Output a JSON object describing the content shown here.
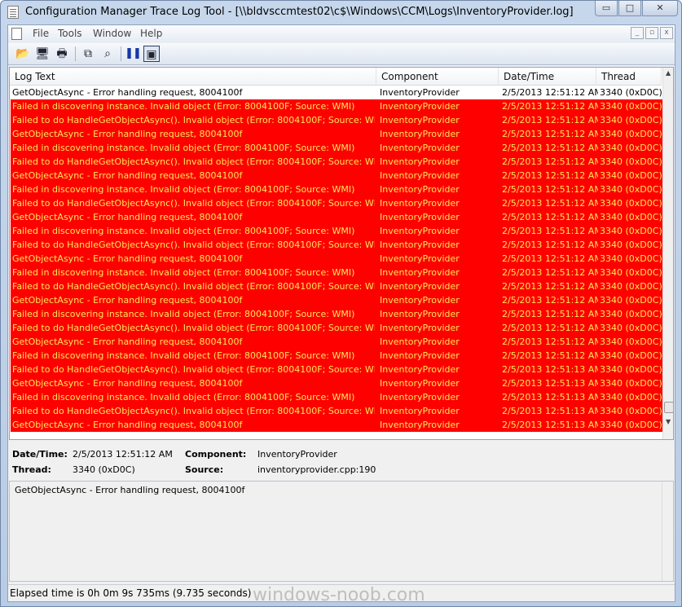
{
  "window": {
    "title": "Configuration Manager Trace Log Tool - [\\\\bldvsccmtest02\\c$\\Windows\\CCM\\Logs\\InventoryProvider.log]",
    "minimize_glyph": "▭",
    "maximize_glyph": "□",
    "close_glyph": "✕"
  },
  "menu": {
    "items": [
      "File",
      "Tools",
      "Window",
      "Help"
    ],
    "mdi_minimize": "_",
    "mdi_restore": "▫",
    "mdi_close": "x"
  },
  "toolbar": {
    "icons": [
      "open-folder-icon",
      "computer-icon",
      "print-icon",
      "copy-icon",
      "find-icon",
      "pause-icon",
      "highlight-icon"
    ],
    "open_glyph": "📂",
    "computer_glyph": "🖥",
    "print_glyph": "🖶",
    "copy_glyph": "⧉",
    "find_glyph": "⌕",
    "pause_glyph": "❚❚",
    "view_glyph": "▣"
  },
  "log": {
    "columns": [
      "Log Text",
      "Component",
      "Date/Time",
      "Thread"
    ],
    "rows": [
      {
        "text": "GetObjectAsync - Error handling request, 8004100f",
        "component": "InventoryProvider",
        "datetime": "2/5/2013 12:51:12 AM",
        "thread": "3340 (0xD0C)"
      },
      {
        "text": "Failed in discovering instance. Invalid object (Error: 8004100F; Source: WMI)",
        "component": "InventoryProvider",
        "datetime": "2/5/2013 12:51:12 AM",
        "thread": "3340 (0xD0C)"
      },
      {
        "text": "Failed to do HandleGetObjectAsync(). Invalid object (Error: 8004100F; Source: WMI)",
        "component": "InventoryProvider",
        "datetime": "2/5/2013 12:51:12 AM",
        "thread": "3340 (0xD0C)"
      },
      {
        "text": "GetObjectAsync - Error handling request, 8004100f",
        "component": "InventoryProvider",
        "datetime": "2/5/2013 12:51:12 AM",
        "thread": "3340 (0xD0C)"
      },
      {
        "text": "Failed in discovering instance. Invalid object (Error: 8004100F; Source: WMI)",
        "component": "InventoryProvider",
        "datetime": "2/5/2013 12:51:12 AM",
        "thread": "3340 (0xD0C)"
      },
      {
        "text": "Failed to do HandleGetObjectAsync(). Invalid object (Error: 8004100F; Source: WMI)",
        "component": "InventoryProvider",
        "datetime": "2/5/2013 12:51:12 AM",
        "thread": "3340 (0xD0C)"
      },
      {
        "text": "GetObjectAsync - Error handling request, 8004100f",
        "component": "InventoryProvider",
        "datetime": "2/5/2013 12:51:12 AM",
        "thread": "3340 (0xD0C)"
      },
      {
        "text": "Failed in discovering instance. Invalid object (Error: 8004100F; Source: WMI)",
        "component": "InventoryProvider",
        "datetime": "2/5/2013 12:51:12 AM",
        "thread": "3340 (0xD0C)"
      },
      {
        "text": "Failed to do HandleGetObjectAsync(). Invalid object (Error: 8004100F; Source: WMI)",
        "component": "InventoryProvider",
        "datetime": "2/5/2013 12:51:12 AM",
        "thread": "3340 (0xD0C)"
      },
      {
        "text": "GetObjectAsync - Error handling request, 8004100f",
        "component": "InventoryProvider",
        "datetime": "2/5/2013 12:51:12 AM",
        "thread": "3340 (0xD0C)"
      },
      {
        "text": "Failed in discovering instance. Invalid object (Error: 8004100F; Source: WMI)",
        "component": "InventoryProvider",
        "datetime": "2/5/2013 12:51:12 AM",
        "thread": "3340 (0xD0C)"
      },
      {
        "text": "Failed to do HandleGetObjectAsync(). Invalid object (Error: 8004100F; Source: WMI)",
        "component": "InventoryProvider",
        "datetime": "2/5/2013 12:51:12 AM",
        "thread": "3340 (0xD0C)"
      },
      {
        "text": "GetObjectAsync - Error handling request, 8004100f",
        "component": "InventoryProvider",
        "datetime": "2/5/2013 12:51:12 AM",
        "thread": "3340 (0xD0C)"
      },
      {
        "text": "Failed in discovering instance. Invalid object (Error: 8004100F; Source: WMI)",
        "component": "InventoryProvider",
        "datetime": "2/5/2013 12:51:12 AM",
        "thread": "3340 (0xD0C)"
      },
      {
        "text": "Failed to do HandleGetObjectAsync(). Invalid object (Error: 8004100F; Source: WMI)",
        "component": "InventoryProvider",
        "datetime": "2/5/2013 12:51:12 AM",
        "thread": "3340 (0xD0C)"
      },
      {
        "text": "GetObjectAsync - Error handling request, 8004100f",
        "component": "InventoryProvider",
        "datetime": "2/5/2013 12:51:12 AM",
        "thread": "3340 (0xD0C)"
      },
      {
        "text": "Failed in discovering instance. Invalid object (Error: 8004100F; Source: WMI)",
        "component": "InventoryProvider",
        "datetime": "2/5/2013 12:51:12 AM",
        "thread": "3340 (0xD0C)"
      },
      {
        "text": "Failed to do HandleGetObjectAsync(). Invalid object (Error: 8004100F; Source: WMI)",
        "component": "InventoryProvider",
        "datetime": "2/5/2013 12:51:12 AM",
        "thread": "3340 (0xD0C)"
      },
      {
        "text": "GetObjectAsync - Error handling request, 8004100f",
        "component": "InventoryProvider",
        "datetime": "2/5/2013 12:51:12 AM",
        "thread": "3340 (0xD0C)"
      },
      {
        "text": "Failed in discovering instance. Invalid object (Error: 8004100F; Source: WMI)",
        "component": "InventoryProvider",
        "datetime": "2/5/2013 12:51:12 AM",
        "thread": "3340 (0xD0C)"
      },
      {
        "text": "Failed to do HandleGetObjectAsync(). Invalid object (Error: 8004100F; Source: WMI)",
        "component": "InventoryProvider",
        "datetime": "2/5/2013 12:51:13 AM",
        "thread": "3340 (0xD0C)"
      },
      {
        "text": "GetObjectAsync - Error handling request, 8004100f",
        "component": "InventoryProvider",
        "datetime": "2/5/2013 12:51:13 AM",
        "thread": "3340 (0xD0C)"
      },
      {
        "text": "Failed in discovering instance. Invalid object (Error: 8004100F; Source: WMI)",
        "component": "InventoryProvider",
        "datetime": "2/5/2013 12:51:13 AM",
        "thread": "3340 (0xD0C)"
      },
      {
        "text": "Failed to do HandleGetObjectAsync(). Invalid object (Error: 8004100F; Source: WMI)",
        "component": "InventoryProvider",
        "datetime": "2/5/2013 12:51:13 AM",
        "thread": "3340 (0xD0C)"
      },
      {
        "text": "GetObjectAsync - Error handling request, 8004100f",
        "component": "InventoryProvider",
        "datetime": "2/5/2013 12:51:13 AM",
        "thread": "3340 (0xD0C)"
      }
    ]
  },
  "details": {
    "datetime_label": "Date/Time:",
    "datetime_value": "2/5/2013 12:51:12 AM",
    "component_label": "Component:",
    "component_value": "InventoryProvider",
    "thread_label": "Thread:",
    "thread_value": "3340 (0xD0C)",
    "source_label": "Source:",
    "source_value": "inventoryprovider.cpp:190"
  },
  "message": {
    "text": "GetObjectAsync - Error handling request, 8004100f"
  },
  "status": {
    "text": "Elapsed time is 0h 0m 9s 735ms (9.735 seconds)",
    "watermark": "windows-noob.com"
  },
  "colors": {
    "error_row_bg": "#ff0000",
    "error_row_text": "#ffe65a"
  }
}
